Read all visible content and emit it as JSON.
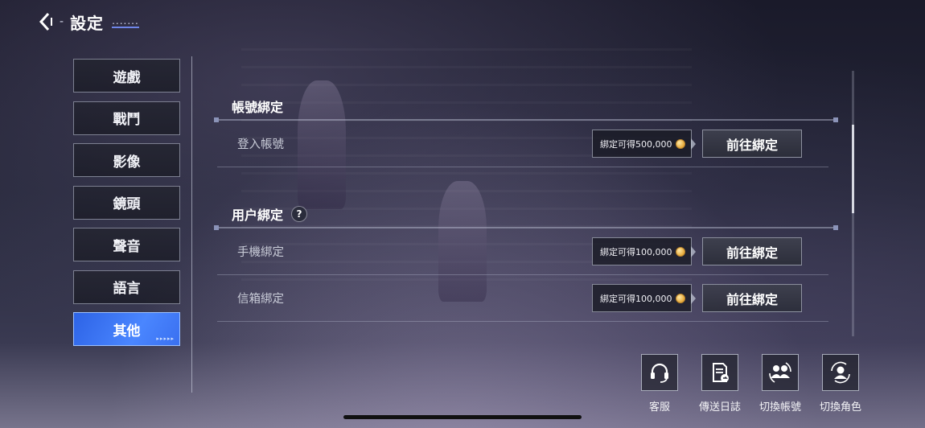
{
  "header": {
    "title": "設定",
    "dash": "-",
    "dots": "......."
  },
  "sidebar": {
    "tabs": [
      {
        "label": "遊戲"
      },
      {
        "label": "戰鬥"
      },
      {
        "label": "影像"
      },
      {
        "label": "鏡頭"
      },
      {
        "label": "聲音"
      },
      {
        "label": "語言"
      },
      {
        "label": "其他",
        "active": true
      }
    ],
    "active_arrows": "▸▸▸▸▸"
  },
  "sections": [
    {
      "title": "帳號綁定",
      "rows": [
        {
          "label": "登入帳號",
          "reward": "綁定可得500,000",
          "button": "前往綁定"
        }
      ]
    },
    {
      "title": "用户綁定",
      "help": "?",
      "rows": [
        {
          "label": "手機綁定",
          "reward": "綁定可得100,000",
          "button": "前往綁定"
        },
        {
          "label": "信箱綁定",
          "reward": "綁定可得100,000",
          "button": "前往綁定"
        }
      ]
    }
  ],
  "actions": [
    {
      "label": "客服",
      "icon": "headset-icon"
    },
    {
      "label": "傳送日誌",
      "icon": "send-log-icon"
    },
    {
      "label": "切換帳號",
      "icon": "switch-account-icon"
    },
    {
      "label": "切換角色",
      "icon": "switch-character-icon"
    }
  ],
  "colors": {
    "active_tab": "#3a70f0",
    "coin": "#e6a93a"
  }
}
